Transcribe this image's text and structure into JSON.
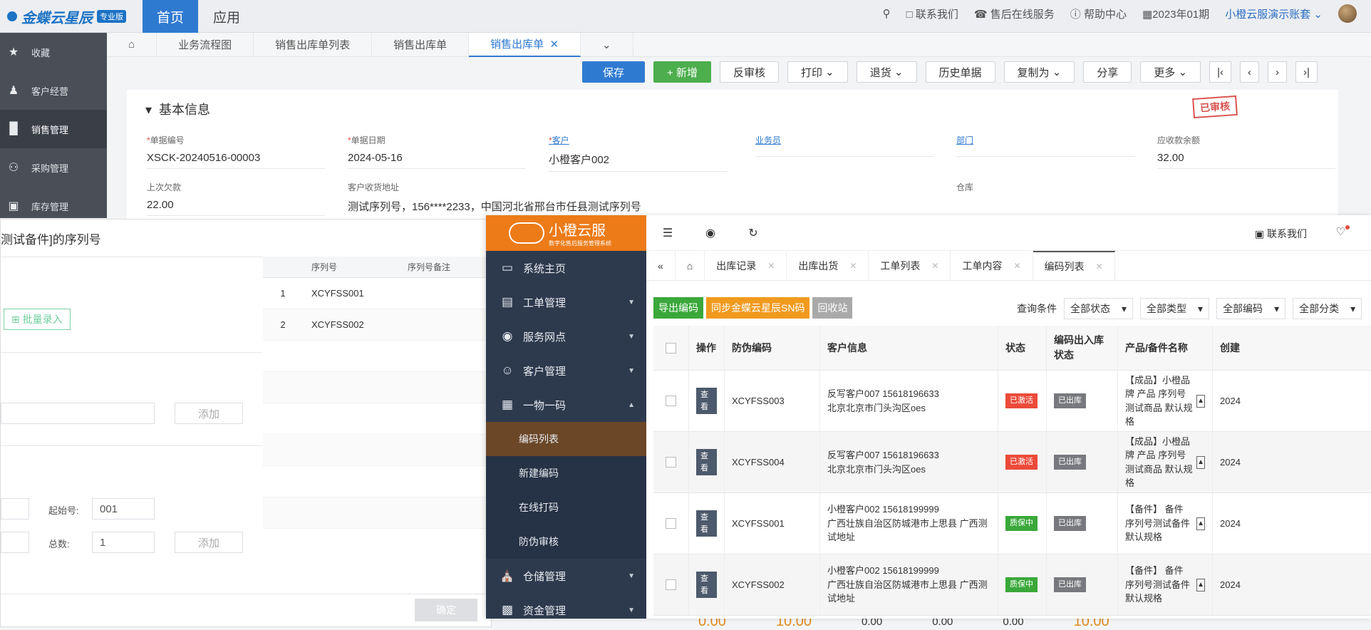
{
  "erp": {
    "logo_brand": "金蝶云星辰",
    "logo_edition": "专业版",
    "nav": [
      "首页",
      "应用"
    ],
    "top_right": {
      "contact": "联系我们",
      "service": "售后在线服务",
      "help": "帮助中心",
      "period": "2023年01期",
      "account": "小橙云服演示账套"
    },
    "sidebar": [
      "收藏",
      "客户经营",
      "销售管理",
      "采购管理",
      "库存管理"
    ],
    "tabs": [
      "业务流程图",
      "销售出库单列表",
      "销售出库单",
      "销售出库单"
    ],
    "toolbar": [
      "保存",
      "+ 新增",
      "反审核",
      "打印",
      "退货",
      "历史单据",
      "复制为",
      "分享",
      "更多"
    ],
    "basic_title": "基本信息",
    "stamp": "已审核",
    "fields": [
      {
        "label": "单据编号",
        "value": "XSCK-20240516-00003",
        "required": true
      },
      {
        "label": "单据日期",
        "value": "2024-05-16",
        "required": true
      },
      {
        "label": "客户",
        "value": "小橙客户002",
        "required": true
      },
      {
        "label": "业务员",
        "value": ""
      },
      {
        "label": "部门",
        "value": ""
      },
      {
        "label": "应收款余额",
        "value": "32.00"
      },
      {
        "label": "上次欠款",
        "value": "22.00"
      },
      {
        "label": "客户收货地址",
        "value": "测试序列号，156****2233，中国河北省邢台市任县测试序列号"
      },
      {
        "label": "仓库",
        "value": ""
      }
    ],
    "footer_values": [
      "0.00",
      "10.00",
      "0.00",
      "0.00",
      "0.00",
      "10.00"
    ]
  },
  "dialog": {
    "title": "测试备件]的序列号",
    "batch_label": "批量录入",
    "add_label": "添加",
    "start_no_label": "起始号:",
    "start_no_value": "001",
    "total_label": "总数:",
    "total_value": "1",
    "table_headers": [
      "序列号",
      "序列号备注"
    ],
    "rows": [
      {
        "idx": "1",
        "sn": "XCYFSS001"
      },
      {
        "idx": "2",
        "sn": "XCYFSS002"
      }
    ],
    "confirm_label": "确定"
  },
  "xc": {
    "logo_name": "小橙云服",
    "logo_sub": "数字化售后服务管理系统",
    "nav": [
      {
        "label": "系统主页",
        "icon": "monitor-icon"
      },
      {
        "label": "工单管理",
        "icon": "document-icon"
      },
      {
        "label": "服务网点",
        "icon": "globe-icon"
      },
      {
        "label": "客户管理",
        "icon": "user-icon"
      },
      {
        "label": "一物一码",
        "icon": "grid-icon"
      }
    ],
    "sub_nav": [
      "编码列表",
      "新建编码",
      "在线打码",
      "防伪审核"
    ],
    "nav_bottom": [
      {
        "label": "仓储管理",
        "icon": "bank-icon"
      },
      {
        "label": "资金管理",
        "icon": "money-icon"
      }
    ],
    "contact": "联系我们",
    "tabs": [
      "出库记录",
      "出库出货",
      "工单列表",
      "工单内容",
      "编码列表"
    ],
    "toolbar": [
      {
        "label": "导出编码",
        "color": "#3aa83a"
      },
      {
        "label": "同步金蝶云星辰SN码",
        "color": "#f09a1e"
      },
      {
        "label": "回收站",
        "color": "#a9a9a9"
      }
    ],
    "filter_label": "查询条件",
    "filters": [
      "全部状态",
      "全部类型",
      "全部编码",
      "全部分类"
    ],
    "table_headers": [
      "操作",
      "防伪编码",
      "客户信息",
      "状态",
      "编码出入库状态",
      "产品/备件名称",
      "创建"
    ],
    "view_label": "查看",
    "rows": [
      {
        "code": "XCYFSS003",
        "customer_line1": "反写客户007 15618196633",
        "customer_line2": "北京北京市门头沟区oes",
        "status": "已激活",
        "status_color": "red",
        "stock": "已出库",
        "product": "【成品】小橙品牌 产品 序列号测试商品 默认规格",
        "created": "2024"
      },
      {
        "code": "XCYFSS004",
        "customer_line1": "反写客户007 15618196633",
        "customer_line2": "北京北京市门头沟区oes",
        "status": "已激活",
        "status_color": "red",
        "stock": "已出库",
        "product": "【成品】小橙品牌 产品 序列号测试商品 默认规格",
        "created": "2024"
      },
      {
        "code": "XCYFSS001",
        "customer_line1": "小橙客户002 15618199999",
        "customer_line2": "广西壮族自治区防城港市上思县 广西测试地址",
        "status": "质保中",
        "status_color": "green",
        "stock": "已出库",
        "product": "【备件】 备件 序列号测试备件 默认规格",
        "created": "2024"
      },
      {
        "code": "XCYFSS002",
        "customer_line1": "小橙客户002 15618199999",
        "customer_line2": "广西壮族自治区防城港市上思县 广西测试地址",
        "status": "质保中",
        "status_color": "green",
        "stock": "已出库",
        "product": "【备件】 备件 序列号测试备件 默认规格",
        "created": "2024"
      }
    ]
  }
}
